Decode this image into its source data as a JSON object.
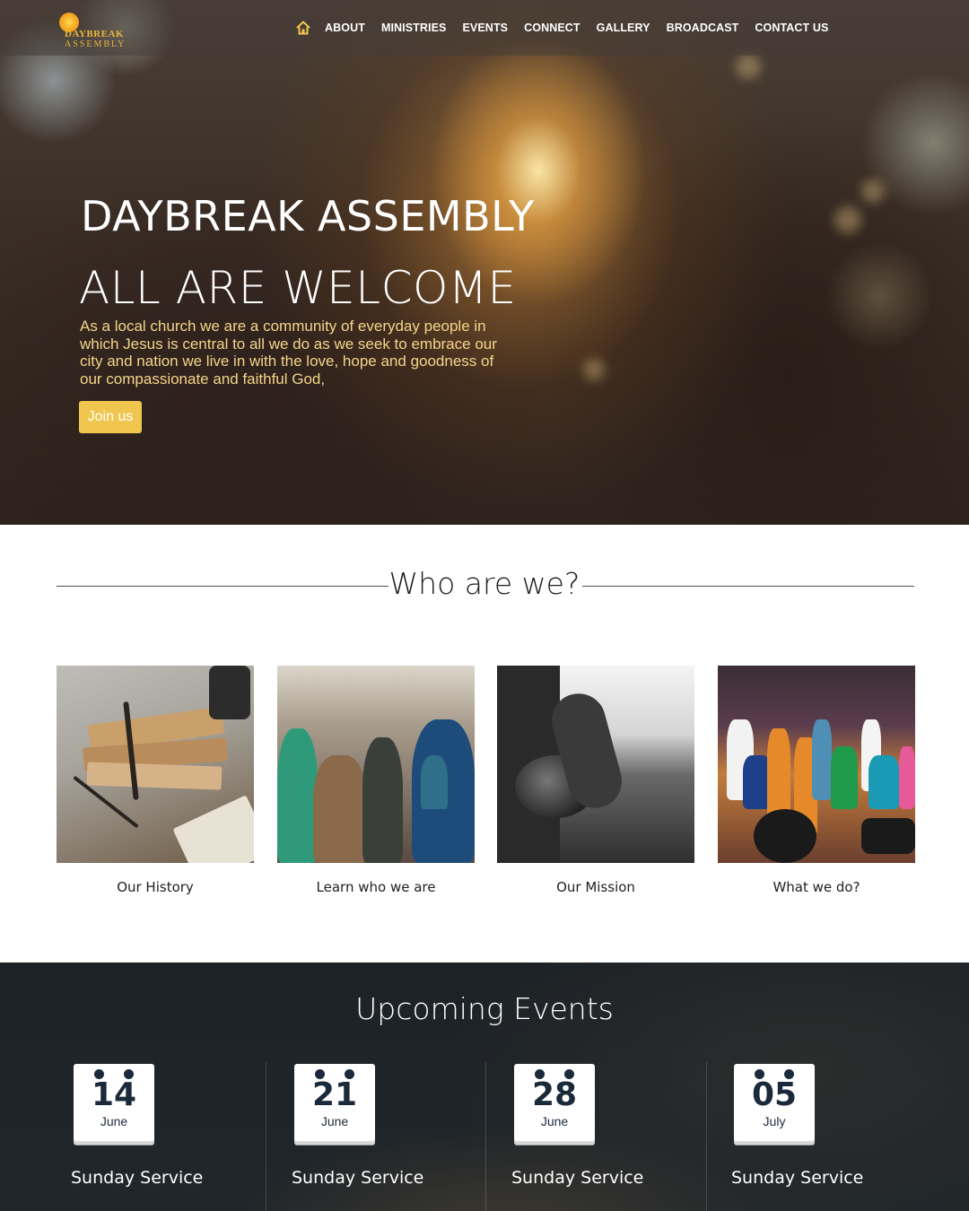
{
  "site": {
    "logo_line_1": "DAYBREAK",
    "logo_line_2": "ASSEMBLY"
  },
  "nav": {
    "home_icon": "home-icon",
    "items": [
      "ABOUT",
      "MINISTRIES",
      "EVENTS",
      "CONNECT",
      "GALLERY",
      "BROADCAST",
      "CONTACT US"
    ]
  },
  "hero": {
    "title": "DAYBREAK ASSEMBLY",
    "subtitle": "ALL ARE WELCOME",
    "text": "As a local church we are a community of everyday people in which Jesus is central to all we do as we seek to embrace our city and nation we live in with the love, hope and goodness of our compassionate and faithful God,",
    "button": "Join us"
  },
  "who": {
    "title": "Who are we?",
    "cards": [
      {
        "label": "Our History"
      },
      {
        "label": "Learn who we are"
      },
      {
        "label": "Our Mission"
      },
      {
        "label": "What we do?"
      }
    ]
  },
  "events": {
    "title": "Upcoming Events",
    "items": [
      {
        "day": "14",
        "month": "June",
        "name": "Sunday Service"
      },
      {
        "day": "21",
        "month": "June",
        "name": "Sunday Service"
      },
      {
        "day": "28",
        "month": "June",
        "name": "Sunday Service"
      },
      {
        "day": "05",
        "month": "July",
        "name": "Sunday Service"
      }
    ]
  },
  "colors": {
    "accent_gold": "#f0c64f",
    "hero_text_gold": "#f2d58a",
    "calendar_navy": "#1b2a3b"
  }
}
